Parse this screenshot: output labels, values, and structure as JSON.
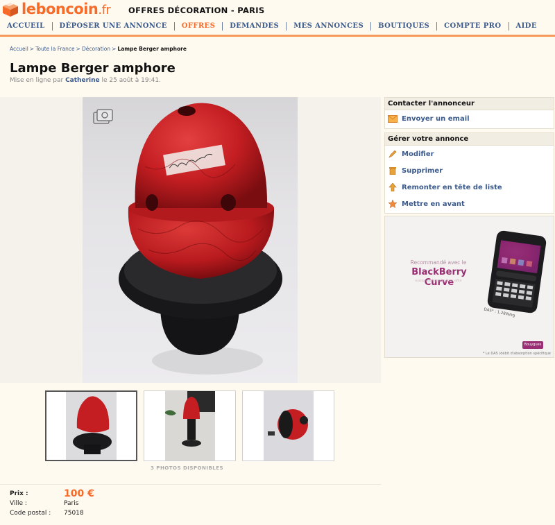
{
  "header": {
    "logo_text": "leboncoin",
    "logo_tld": ".fr",
    "section_title": "OFFRES DÉCORATION - PARIS",
    "brand_color": "#f56b2a",
    "link_color": "#3a5a8c"
  },
  "nav": [
    {
      "label": "ACCUEIL",
      "active": false
    },
    {
      "label": "DÉPOSER UNE ANNONCE",
      "active": false
    },
    {
      "label": "OFFRES",
      "active": true
    },
    {
      "label": "DEMANDES",
      "active": false
    },
    {
      "label": "MES ANNONCES",
      "active": false
    },
    {
      "label": "BOUTIQUES",
      "active": false
    },
    {
      "label": "COMPTE PRO",
      "active": false
    },
    {
      "label": "AIDE",
      "active": false
    }
  ],
  "breadcrumb": {
    "items": [
      "Accueil",
      "Toute la France",
      "Décoration"
    ],
    "separator": ">",
    "current": "Lampe Berger amphore"
  },
  "ad": {
    "title": "Lampe Berger amphore",
    "posted_prefix": "Mise en ligne par",
    "author": "Catherine",
    "posted_suffix": "le 25 août à 19:41.",
    "photos_available": "3 PHOTOS DISPONIBLES",
    "selected_thumb": 0
  },
  "contact_panel": {
    "title": "Contacter l'annonceur",
    "email_label": "Envoyer un email",
    "email_icon": "envelope-icon"
  },
  "manage_panel": {
    "title": "Gérer votre annonce",
    "items": [
      {
        "label": "Modifier",
        "icon": "pencil-icon"
      },
      {
        "label": "Supprimer",
        "icon": "trash-icon"
      },
      {
        "label": "Remonter en tête de liste",
        "icon": "arrow-up-icon"
      },
      {
        "label": "Mettre en avant",
        "icon": "star-icon"
      }
    ]
  },
  "banner": {
    "line1": "Recommandé avec le",
    "brand": "BlackBerry Curve",
    "line3": "existe voir conseils dans offre",
    "das": "DAS* : 1,28W/kg",
    "footnote": "* Le DAS (débit d'absorption spécifique",
    "badge": "Bouygues",
    "brand_color": "#9a2e72"
  },
  "details": {
    "price_label": "Prix :",
    "price_value": "100 €",
    "city_label": "Ville :",
    "city_value": "Paris",
    "postal_label": "Code postal :",
    "postal_value": "75018"
  }
}
